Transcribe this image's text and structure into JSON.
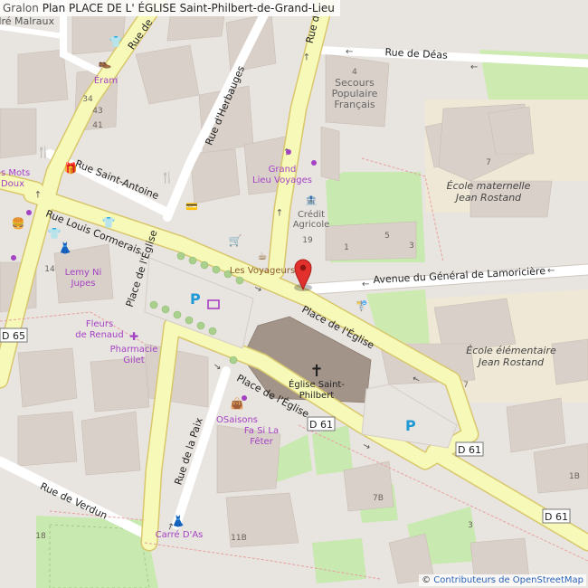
{
  "header": {
    "app_name": "Gralon",
    "title": "Plan PLACE DE L' ÉGLISE Saint-Philbert-de-Grand-Lieu"
  },
  "attribution": {
    "symbol": "©",
    "text": "Contributeurs de OpenStreetMap"
  },
  "colors": {
    "road_major": "#f7f9b8",
    "road_major_casing": "#d8c76c",
    "building": "#d9d0c9",
    "church": "#a3948a",
    "park": "#cdebb0",
    "grass": "#c8e9b0",
    "poi": "#a442c4",
    "parking": "#1d9ad6",
    "marker": "#e2312c"
  },
  "streets": {
    "rue_de_deas": "Rue de Déas",
    "avenue_lamoriciere": "Avenue du Général de Lamoricière",
    "place_eglise_1": "Place de l'Église",
    "place_eglise_2": "Place de l'Église",
    "place_eglise_3": "Place de l'Église",
    "rue_herbauges": "Rue d'Herbauges",
    "rue_saint_antoine": "Rue Saint-Antoine",
    "rue_louis_cormerais": "Rue Louis Cormerais",
    "rue_de_la_paix": "Rue de la Paix",
    "rue_de_verdun": "Rue de Verdun",
    "rue_de_top": "Rue de",
    "rue_de_left": "Rue de"
  },
  "road_refs": {
    "d61_a": "D 61",
    "d61_b": "D 61",
    "d61_c": "D 61",
    "d65": "D 65"
  },
  "places": {
    "andre_malraux": "André Malraux",
    "secours_line1": "Secours",
    "secours_line2": "Populaire",
    "secours_line3": "Français",
    "ecole_maternelle_1": "École maternelle",
    "ecole_maternelle_2": "Jean Rostand",
    "ecole_elementaire_1": "École élémentaire",
    "ecole_elementaire_2": "Jean Rostand",
    "eglise_1": "Église Saint-",
    "eglise_2": "Philbert",
    "credit_1": "Crédit",
    "credit_2": "Agricole",
    "grand_lieu_1": "Grand",
    "grand_lieu_2": "Lieu Voyages",
    "les_voyageurs": "Les Voyageurs",
    "eram": "Éram",
    "mots_1": "es Mots",
    "mots_2": "Doux",
    "lemy_1": "Lemy Ni",
    "lemy_2": "Jupes",
    "fleurs_1": "Fleurs",
    "fleurs_2": "de Renaud",
    "pharmacie_1": "Pharmacie",
    "pharmacie_2": "Gilet",
    "osaisons": "OSaisons",
    "fasi_1": "Fa Si La",
    "fasi_2": "Fêter",
    "carre": "Carré D'As"
  },
  "house_numbers": {
    "n4": "4",
    "n7a": "7",
    "n19": "19",
    "n1": "1",
    "n5": "5",
    "n3": "3",
    "n7b": "7",
    "n34": "34",
    "n43": "43",
    "n41": "41",
    "n14": "14",
    "n7B": "7B",
    "n11B": "11B",
    "n18": "18",
    "n1B": "1B",
    "n3b": "3"
  },
  "map_labels": {
    "parking": "P"
  }
}
